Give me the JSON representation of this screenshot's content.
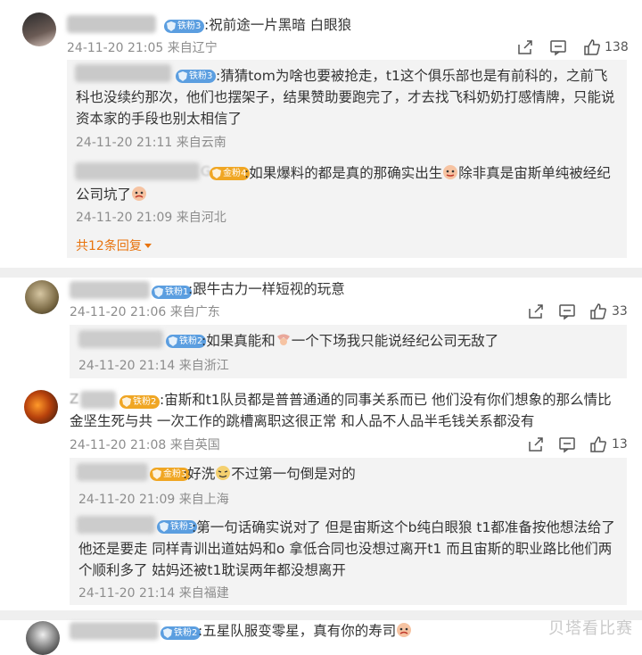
{
  "comments": [
    {
      "badge": "铁粉3",
      "text": ":祝前途一片黑暗 白眼狼",
      "meta": "24-11-20 21:05 来自辽宁",
      "likes": "138",
      "replies": [
        {
          "badge": "铁粉3",
          "text": ":猜猜tom为啥也要被抢走，t1这个俱乐部也是有前科的，之前飞科也没续约那次，他们也摆架子，结果赞助要跑完了，才去找飞科奶奶打感情牌，只能说资本家的手段也别太相信了",
          "meta": "24-11-20 21:11 来自云南"
        },
        {
          "name_tail": "G",
          "badge": "金粉4",
          "text_a": ":如果爆料的都是真的那确实出生",
          "text_b": "除非真是宙斯单纯被经纪公司坑了",
          "meta": "24-11-20 21:09 来自河北"
        }
      ],
      "more_replies": "共12条回复"
    },
    {
      "badge": "铁粉1",
      "text": ":跟牛古力一样短视的玩意",
      "meta": "24-11-20 21:06 来自广东",
      "likes": "33",
      "replies": [
        {
          "badge": "铁粉2",
          "text_a": ":如果真能和",
          "text_b": "一个下场我只能说经纪公司无敌了",
          "meta": "24-11-20 21:14 来自浙江"
        }
      ]
    },
    {
      "name_head": "Z",
      "badge": "铁粉2",
      "text": ":宙斯和t1队员都是普普通通的同事关系而已 他们没有你们想象的那么情比金坚生死与共 一次工作的跳槽离职这很正常 和人品不人品半毛钱关系都没有",
      "meta": "24-11-20 21:08 来自英国",
      "likes": "13",
      "replies": [
        {
          "badge": "金粉3",
          "text_a": ":好洗",
          "text_b": "不过第一句倒是对的",
          "meta": "24-11-20 21:09 来自上海"
        },
        {
          "badge": "铁粉3",
          "text": ":第一句话确实说对了 但是宙斯这个b纯白眼狼 t1都准备按他想法给了 他还是要走  同样青训出道姑妈和o 拿低合同也没想过离开t1 而且宙斯的职业路比他们两个顺利多了 姑妈还被t1耽误两年都没想离开",
          "meta": "24-11-20 21:14 来自福建"
        }
      ]
    },
    {
      "badge": "铁粉2",
      "text": ":五星队服变零星，真有你的寿司"
    }
  ],
  "watermark": "贝塔看比赛",
  "colors": {
    "badge_blue": "#5b9ee0",
    "badge_gold": "#f0a623",
    "more_link": "#e8730d",
    "meta_gray": "#8d8d8d",
    "reply_bg": "#f3f3f3",
    "separator": "#efefef"
  },
  "icons": [
    "share-icon",
    "comment-icon",
    "like-icon",
    "fan-badge-icon",
    "dropdown-arrow-icon",
    "emoji-icon"
  ]
}
